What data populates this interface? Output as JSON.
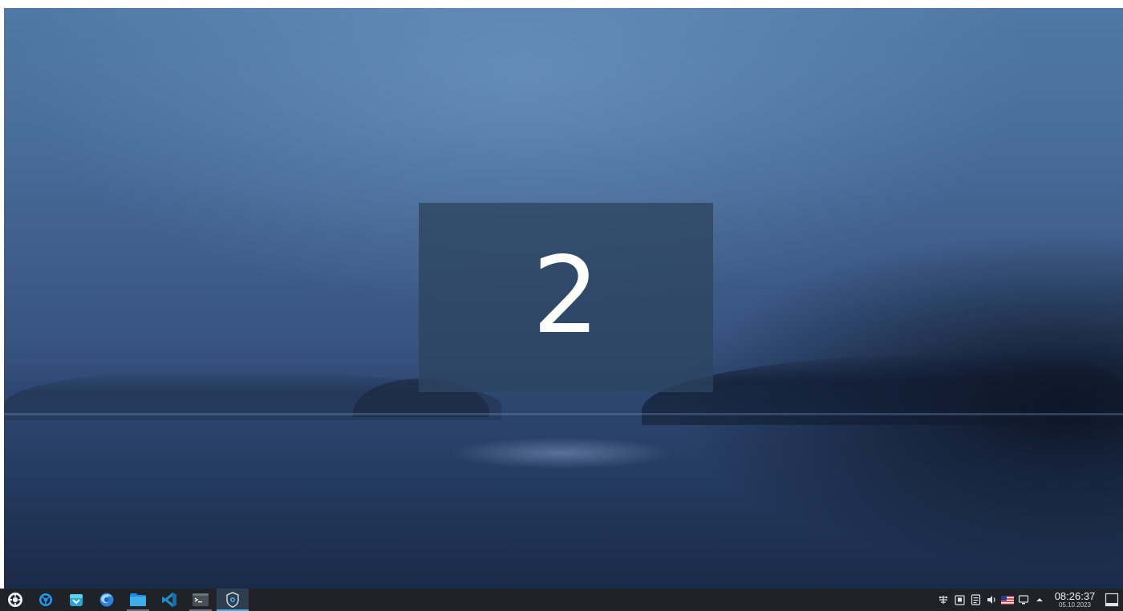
{
  "desktop": {
    "wallpaper": "foggy-lake",
    "current_desktop_label": "2"
  },
  "taskbar": {
    "launchers": [
      {
        "name": "app-launcher-icon"
      },
      {
        "name": "browser-icon"
      },
      {
        "name": "software-center-icon"
      },
      {
        "name": "firefox-icon"
      },
      {
        "name": "file-manager-icon"
      },
      {
        "name": "vscode-icon"
      },
      {
        "name": "terminal-icon"
      },
      {
        "name": "vpn-shield-icon"
      }
    ],
    "tray": {
      "icons": [
        "network-icon",
        "clipboard-icon",
        "notes-icon",
        "volume-icon",
        "keyboard-layout-flag-icon",
        "display-icon",
        "expand-tray-icon"
      ],
      "time": "08:26:37",
      "date": "05.10.2023"
    }
  },
  "colors": {
    "panel": "#1f2328",
    "accent": "#3daee9",
    "osd": "#2d4460"
  }
}
